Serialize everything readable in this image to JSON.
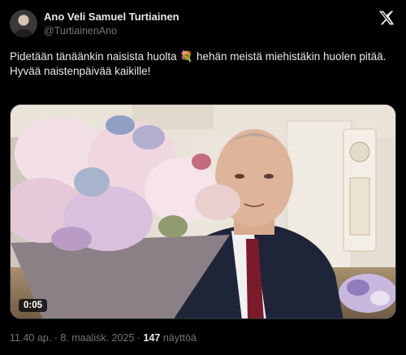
{
  "author": {
    "display_name": "Ano Veli Samuel Turtiainen",
    "handle": "@TurtiainenAno",
    "avatar": "author-avatar"
  },
  "tweet": {
    "text_line1": "Pidetään tänäänkin naisista huolta 💐 hehän meistä miehistäkin huolen pitää.",
    "text_line2": "Hyvää naistenpäivää kaikille!"
  },
  "media": {
    "type": "video",
    "timecode": "0:05"
  },
  "meta": {
    "time": "11.40 ap.",
    "separator": "·",
    "date": "8. maalisk. 2025",
    "views_count": "147",
    "views_label": "näyttöä"
  },
  "icons": {
    "brand": "x-logo-icon"
  },
  "colors": {
    "background": "#000000",
    "text": "#e7e9ea",
    "muted": "#71767b"
  }
}
